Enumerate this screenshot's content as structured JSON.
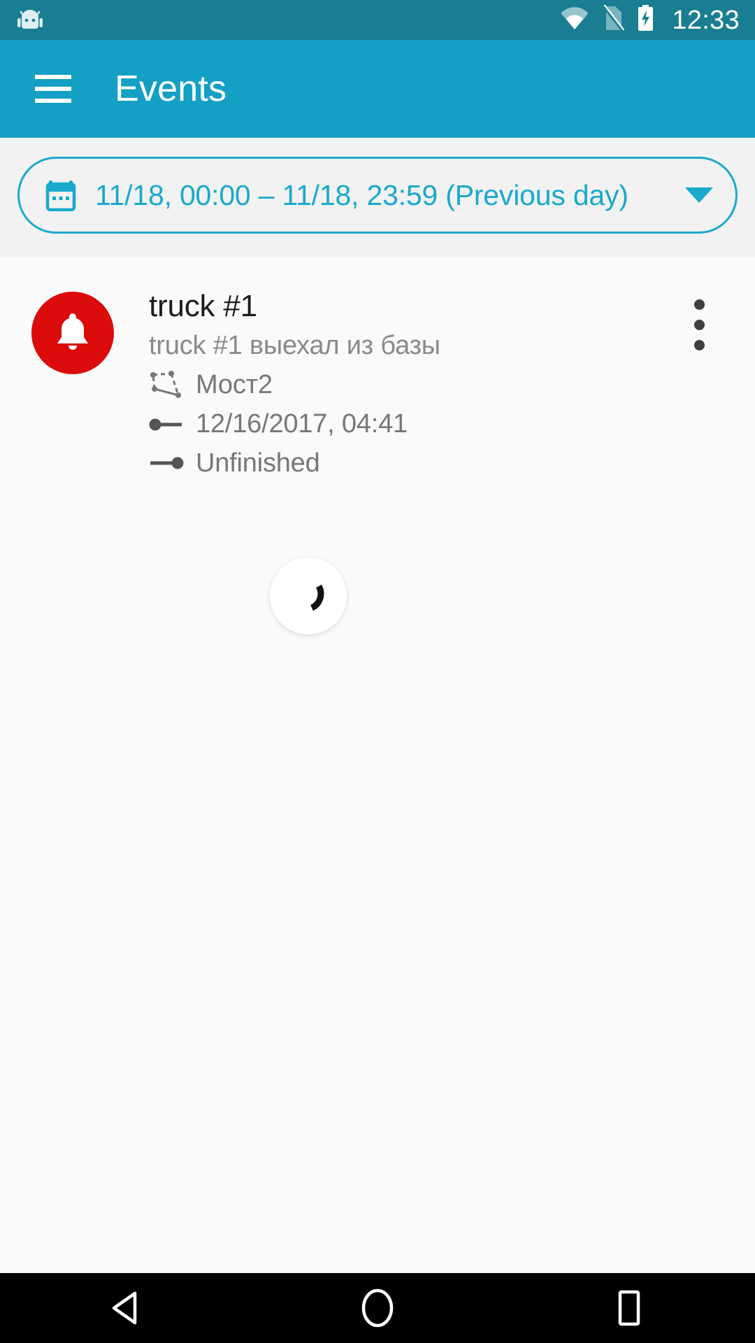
{
  "statusbar": {
    "clock": "12:33",
    "icons": [
      "android-robot-icon",
      "wifi-icon",
      "no-sim-icon",
      "battery-charging-icon"
    ]
  },
  "appbar": {
    "menu_icon": "hamburger-menu-icon",
    "title": "Events"
  },
  "filter": {
    "calendar_icon": "calendar-icon",
    "date_range": "11/18, 00:00 – 11/18, 23:59 (Previous day)",
    "dropdown_icon": "chevron-down-icon"
  },
  "events": [
    {
      "avatar_icon": "bell-icon",
      "avatar_color": "#db0b0b",
      "title": "truck #1",
      "subtitle": "truck #1 выехал из базы",
      "geofence_icon": "geofence-polygon-icon",
      "geofence": "Мост2",
      "start_icon": "event-start-icon",
      "start_time": "12/16/2017, 04:41",
      "end_icon": "event-end-icon",
      "end_status": "Unfinished",
      "overflow_icon": "more-vertical-icon"
    }
  ],
  "loading": {
    "spinner_icon": "loading-spinner-icon",
    "visible": true
  },
  "navbar": {
    "back": "back-triangle-icon",
    "home": "home-circle-icon",
    "recents": "recents-square-icon"
  },
  "colors": {
    "statusbar": "#1a7e92",
    "appbar": "#14a0c4",
    "accent": "#19a9cd",
    "alert": "#db0b0b",
    "background": "#fafafa",
    "filter_strip": "#f2f2f2"
  }
}
